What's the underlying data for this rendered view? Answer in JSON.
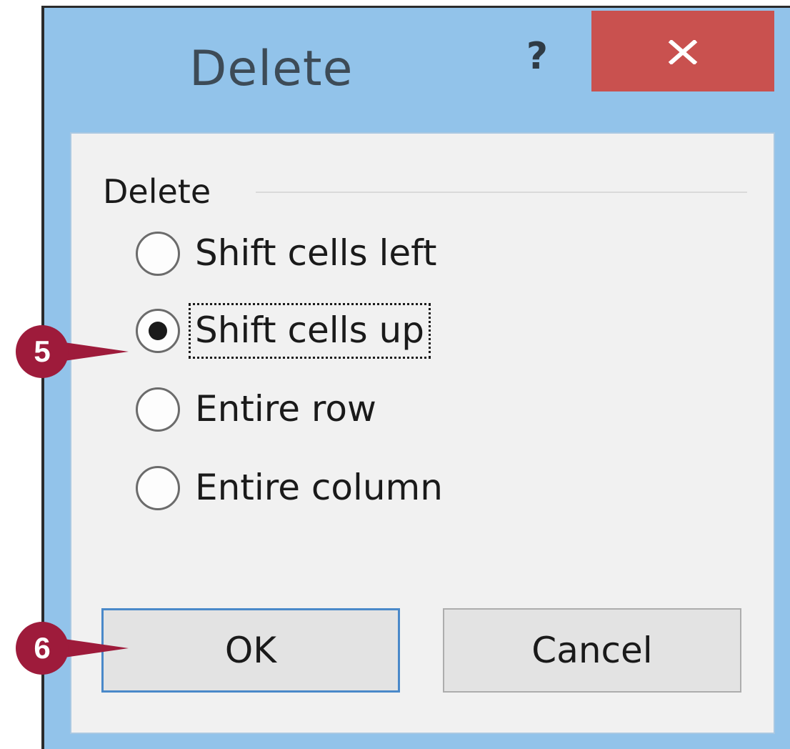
{
  "dialog": {
    "title": "Delete",
    "help_label": "?",
    "close_icon": "close-icon",
    "colors": {
      "frame": "#92c3ea",
      "close_bg": "#c9514f",
      "client_bg": "#f1f1f1",
      "ok_border": "#4a89c9",
      "callout": "#9e1b3b"
    }
  },
  "group": {
    "label": "Delete",
    "options": [
      {
        "label": "Shift cells left",
        "checked": false
      },
      {
        "label": "Shift cells up",
        "checked": true
      },
      {
        "label": "Entire row",
        "checked": false
      },
      {
        "label": "Entire column",
        "checked": false
      }
    ]
  },
  "buttons": {
    "ok": "OK",
    "cancel": "Cancel"
  },
  "callouts": {
    "step5": "5",
    "step6": "6"
  }
}
